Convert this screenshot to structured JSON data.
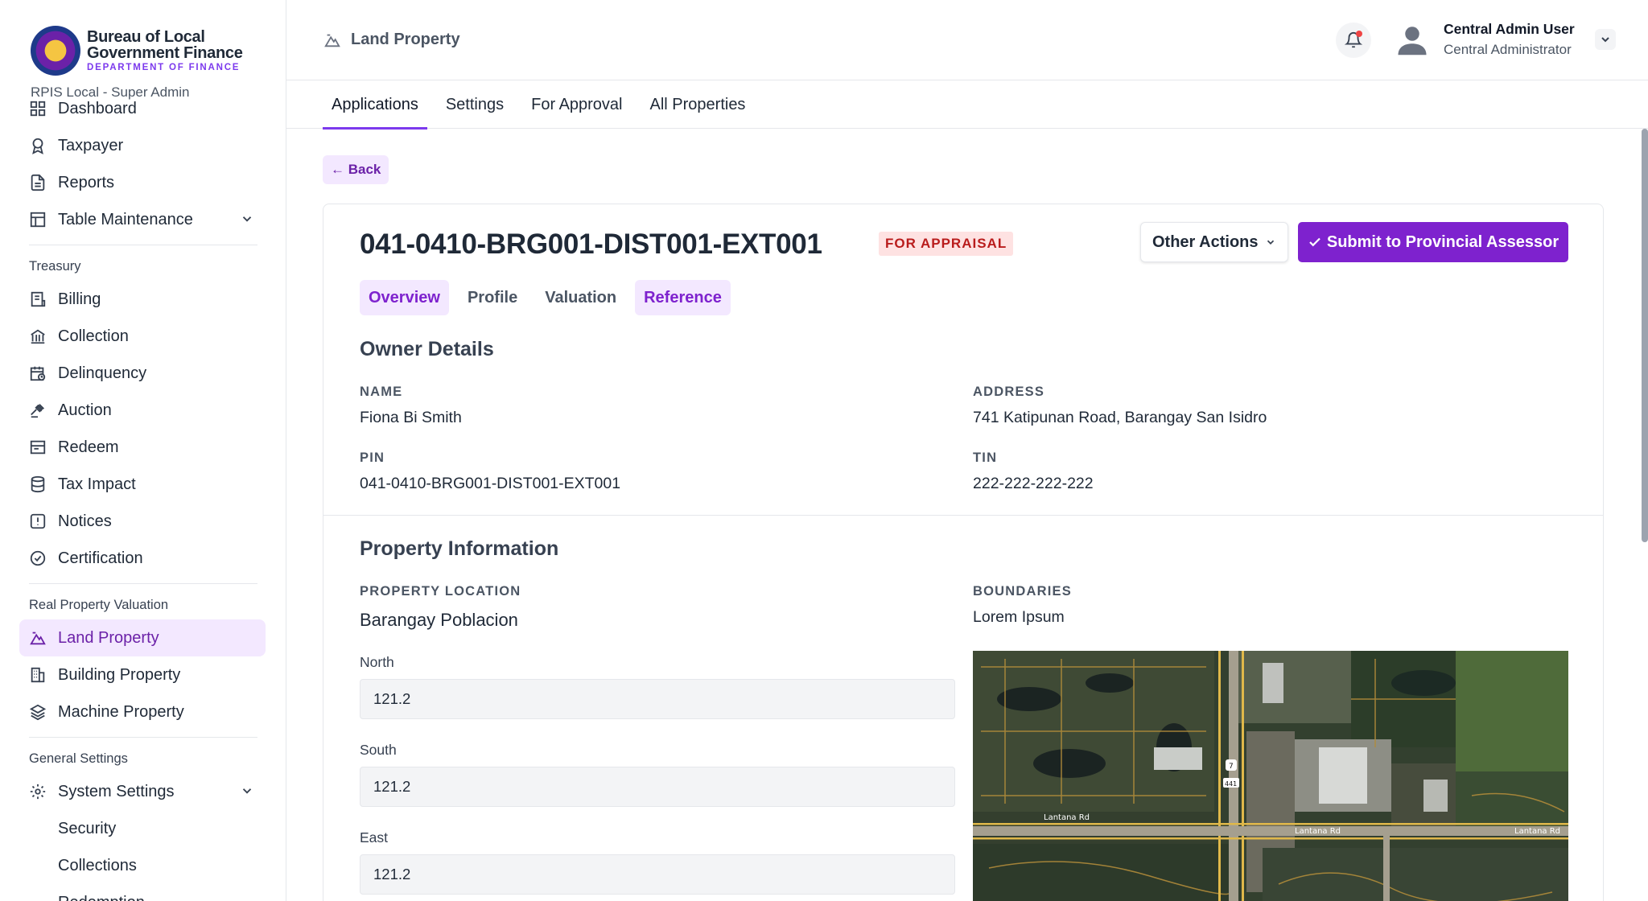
{
  "brand": {
    "line1": "Bureau of Local",
    "line2": "Government Finance",
    "line3": "DEPARTMENT OF FINANCE",
    "role": "RPIS Local - Super Admin"
  },
  "sidebar": {
    "items_top": [
      "Dashboard",
      "Taxpayer",
      "Reports",
      "Table Maintenance"
    ],
    "section_treasury": "Treasury",
    "items_treasury": [
      "Billing",
      "Collection",
      "Delinquency",
      "Auction",
      "Redeem",
      "Tax Impact",
      "Notices",
      "Certification"
    ],
    "section_rpv": "Real Property Valuation",
    "items_rpv": [
      "Land Property",
      "Building Property",
      "Machine Property"
    ],
    "section_general": "General Settings",
    "system_settings": "System Settings",
    "sub_items": [
      "Security",
      "Collections",
      "Redemption"
    ]
  },
  "header": {
    "title": "Land Property",
    "user_name": "Central Admin User",
    "user_role": "Central Administrator"
  },
  "tabs": [
    "Applications",
    "Settings",
    "For Approval",
    "All Properties"
  ],
  "back_label": "Back",
  "record": {
    "pin": "041-0410-BRG001-DIST001-EXT001",
    "status": "FOR APPRAISAL",
    "other_actions": "Other Actions",
    "submit": "Submit to Provincial Assessor",
    "subtabs": [
      "Overview",
      "Profile",
      "Valuation",
      "Reference"
    ]
  },
  "owner": {
    "title": "Owner Details",
    "name_label": "NAME",
    "name": "Fiona Bi Smith",
    "address_label": "ADDRESS",
    "address": "741 Katipunan Road, Barangay San Isidro",
    "pin_label": "PIN",
    "pin": "041-0410-BRG001-DIST001-EXT001",
    "tin_label": "TIN",
    "tin": "222-222-222-222"
  },
  "property": {
    "title": "Property Information",
    "location_label": "PROPERTY LOCATION",
    "location": "Barangay Poblacion",
    "boundaries_label": "BOUNDARIES",
    "boundaries": "Lorem Ipsum",
    "north_label": "North",
    "north": "121.2",
    "south_label": "South",
    "south": "121.2",
    "east_label": "East",
    "east": "121.2"
  },
  "map": {
    "road1": "Lantana Rd",
    "road2": "Lantana Rd",
    "road3": "Lantana Rd",
    "shield1": "7",
    "shield2": "441"
  },
  "colors": {
    "accent": "#7e22ce",
    "accent_soft": "#f3e8ff",
    "status_bg": "#fee2e2",
    "status_text": "#b91c1c"
  }
}
